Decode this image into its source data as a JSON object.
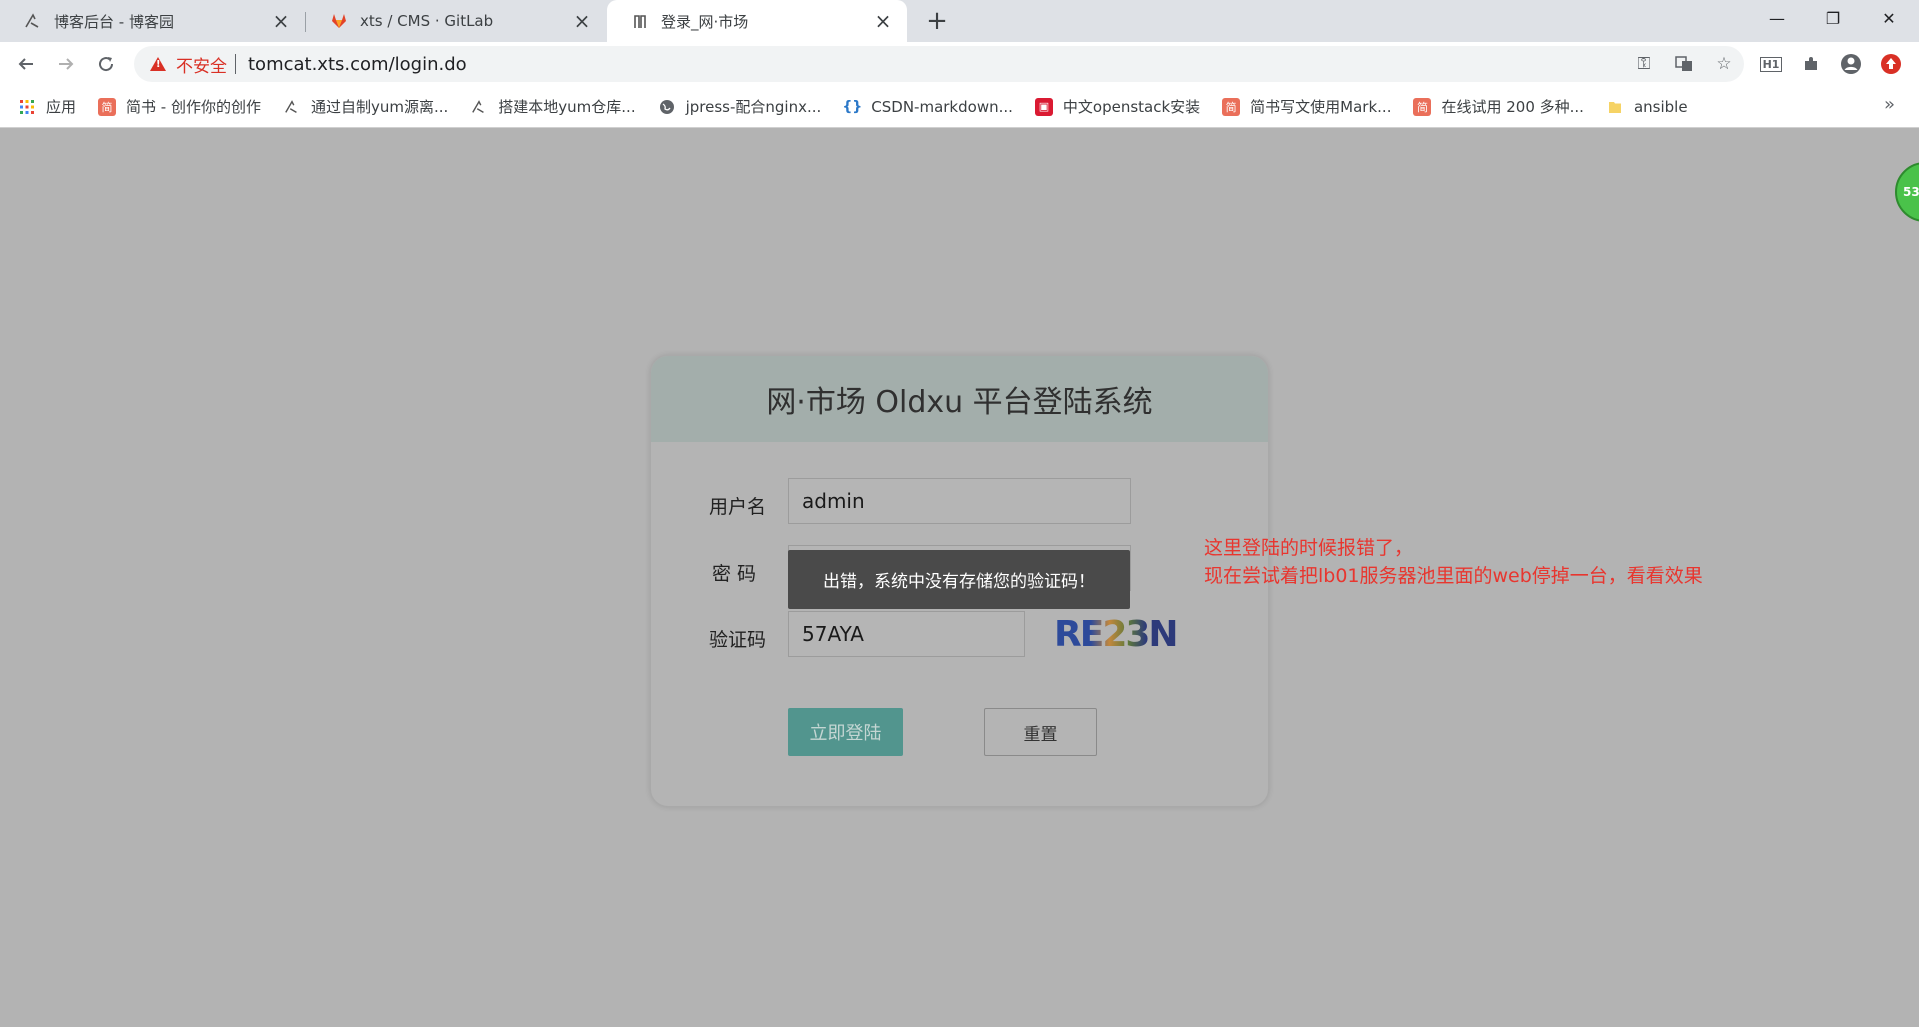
{
  "tabs": [
    {
      "title": "博客后台 - 博客园",
      "active": false
    },
    {
      "title": "xts / CMS · GitLab",
      "active": false
    },
    {
      "title": "登录_网·市场",
      "active": true
    }
  ],
  "toolbar": {
    "security_label": "不安全",
    "url": "tomcat.xts.com/login.do"
  },
  "bookmarks": [
    {
      "label": "应用",
      "icon": "apps-grid-icon"
    },
    {
      "label": "简书 - 创作你的创作",
      "icon": "jianshu-icon"
    },
    {
      "label": "通过自制yum源离...",
      "icon": "cnblogs-icon"
    },
    {
      "label": "搭建本地yum仓库...",
      "icon": "cnblogs-icon"
    },
    {
      "label": "jpress-配合nginx...",
      "icon": "globe-icon"
    },
    {
      "label": "CSDN-markdown...",
      "icon": "csdn-icon"
    },
    {
      "label": "中文openstack安装",
      "icon": "openstack-icon"
    },
    {
      "label": "简书写文使用Mark...",
      "icon": "jianshu-icon"
    },
    {
      "label": "在线试用 200 多种...",
      "icon": "jianshu-icon"
    },
    {
      "label": "ansible",
      "icon": "folder-icon"
    }
  ],
  "login": {
    "title": "网·市场 Oldxu 平台登陆系统",
    "username_label": "用户名",
    "username_value": "admin",
    "password_label": "密 码",
    "password_value": "••••",
    "captcha_label": "验证码",
    "captcha_value": "57AYA",
    "captcha_image_text": "RE23N",
    "login_button": "立即登陆",
    "reset_button": "重置"
  },
  "toast": {
    "message": "出错，系统中没有存储您的验证码！"
  },
  "annotation": {
    "line1": "这里登陆的时候报错了，",
    "line2": "现在尝试着把lb01服务器池里面的web停掉一台，看看效果"
  },
  "float_badge": {
    "text": "53"
  },
  "colors": {
    "annotation": "#e8362f",
    "login_button": "#52958e",
    "insecure": "#d93025"
  }
}
